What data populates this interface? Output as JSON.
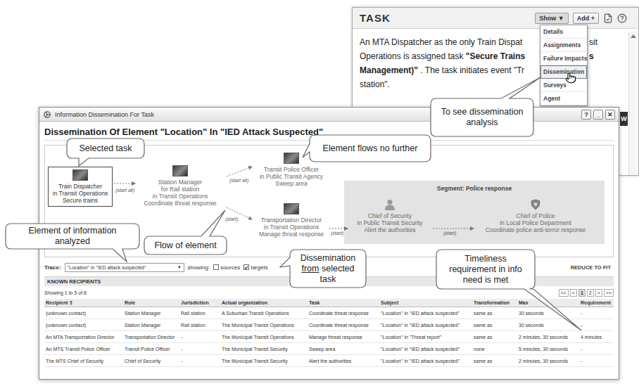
{
  "back_window": {
    "title": "TASK",
    "buttons": [
      {
        "label": "Show ▼",
        "open": true
      },
      {
        "label": "Add +",
        "open": false
      }
    ],
    "body_lines": [
      {
        "left": [
          {
            "text": "An MTA Dispatcher as the only Train Dispat",
            "bold": false
          }
        ],
        "right": [
          {
            "text": "sit",
            "bold": false
          }
        ]
      },
      {
        "left": [
          {
            "text": "Operations is assigned task ",
            "bold": false
          },
          {
            "text": "\"Secure Trains",
            "bold": true
          }
        ],
        "right": [
          {
            "text": "s",
            "bold": true
          }
        ]
      },
      {
        "left": [
          {
            "text": "Management)\"",
            "bold": true
          },
          {
            "text": " . The task initiates event \"Tr",
            "bold": false
          }
        ],
        "right": []
      },
      {
        "left": [
          {
            "text": "station\".",
            "bold": false
          }
        ],
        "right": []
      }
    ],
    "menu": [
      {
        "label": "Details",
        "selected": false
      },
      {
        "label": "Assignments",
        "selected": false
      },
      {
        "label": "Failure Impacts",
        "selected": false
      },
      {
        "label": "Dissemination",
        "selected": true
      },
      {
        "label": "Surveys",
        "selected": false
      },
      {
        "label": "Agent",
        "selected": false
      }
    ],
    "edge_tab": "W"
  },
  "window": {
    "title": "Information Dissemination For Task",
    "buttons": [
      "?",
      "_",
      "✕"
    ]
  },
  "heading": "Dissemination Of Element \"Location\" In \"IED Attack Suspected\"",
  "diagram": {
    "segment": {
      "title": "Segment: Police response"
    },
    "nodes": [
      {
        "kind": "photo",
        "selected": true,
        "lines": [
          "Train Dispatcher",
          "in Transit Operations",
          "Secure trains"
        ]
      },
      {
        "kind": "photo",
        "selected": false,
        "lines": [
          "Station Manager",
          "for Rail station",
          "in Transit Operations",
          "Coordinate threat response"
        ]
      },
      {
        "kind": "photo",
        "selected": false,
        "lines": [
          "Transit Police Officer",
          "in Public Transit Agency",
          "Sweep area"
        ]
      },
      {
        "kind": "photo",
        "selected": false,
        "lines": [
          "Transportation Director",
          "in Transit Operations",
          "Manage threat response"
        ]
      },
      {
        "kind": "person",
        "selected": false,
        "lines": [
          "Chief of Security",
          "in Public Transit Security",
          "Alert the authorities"
        ]
      },
      {
        "kind": "badge",
        "selected": false,
        "lines": [
          "Chief of Police",
          "in Local Police Department",
          "Coordinate police anti-terror response"
        ]
      }
    ],
    "edges": [
      {
        "from": 0,
        "to": 1,
        "label": "(start all)"
      },
      {
        "from": 1,
        "to": 2,
        "label": "(start all)"
      },
      {
        "from": 1,
        "to": 3,
        "label": "(start)"
      },
      {
        "from": 3,
        "to": 4,
        "label": "(start)"
      },
      {
        "from": 4,
        "to": 5,
        "label": "(start)"
      }
    ]
  },
  "trace": {
    "label": "Trace:",
    "value": "\"Location\" in \"IED attack suspected\"",
    "arrow": "▼",
    "showing_label": "showing:",
    "options": [
      {
        "label": "sources",
        "checked": false
      },
      {
        "label": "targets",
        "checked": true
      }
    ],
    "reduce": "REDUCE TO FIT"
  },
  "recipients": {
    "title": "KNOWN RECIPIENTS",
    "showing": "Showing 1 to 5 of 8",
    "pages": [
      {
        "label": "<<",
        "selected": false
      },
      {
        "label": "<",
        "selected": false
      },
      {
        "label": "1",
        "selected": true
      },
      {
        "label": "2",
        "selected": false
      },
      {
        "label": ">",
        "selected": false
      },
      {
        "label": ">>",
        "selected": false
      }
    ],
    "sort_glyph": "⇧",
    "columns": [
      "Recipient",
      "Role",
      "Jurisdiction",
      "Actual organization",
      "Task",
      "Subject",
      "Transformation",
      "Max",
      "Requirement"
    ],
    "rows": [
      [
        "(unknown contact)",
        "Station Manager",
        "Rail station",
        "A Suburban Transit Operations",
        "Coordinate threat response",
        "\"Location\" in \"IED attack suspected\"",
        "same as",
        "30 seconds",
        "-"
      ],
      [
        "(unknown contact)",
        "Station Manager",
        "Rail station",
        "The Municipal Transit Operations",
        "Coordinate threat response",
        "\"Location\" in \"IED attack suspected\"",
        "same as",
        "30 seconds",
        "-"
      ],
      [
        "An MTA Transportation Director",
        "Transportation Director",
        "-",
        "The Municipal Transit Operations",
        "Manage threat response",
        "\"Location\" in \"Threat report\"",
        "same as",
        "2 minutes, 30 seconds",
        "4 minutes"
      ],
      [
        "An MTS Transit Police Officer",
        "Transit Police Officer",
        "-",
        "The Municipal Transit Security",
        "Sweep area",
        "\"Location\" in \"IED attack suspected\"",
        "none",
        "5 minutes, 30 seconds",
        "-"
      ],
      [
        "The MTS Chief of Security",
        "Chief of Security",
        "-",
        "The Municipal Transit Security",
        "Alert the authorities",
        "\"Location\" in \"IED attack suspected\"",
        "same as",
        "2 minutes, 30 seconds",
        "-"
      ]
    ]
  },
  "callouts": [
    {
      "text": [
        {
          "text": "Selected task",
          "underline": false
        }
      ]
    },
    {
      "text": [
        {
          "text": "Element flows no further",
          "underline": false
        }
      ]
    },
    {
      "text": [
        {
          "text": "Element of information analyzed",
          "underline": false
        }
      ]
    },
    {
      "text": [
        {
          "text": "Flow of element",
          "underline": false
        }
      ]
    },
    {
      "text": [
        {
          "text": "Dissemination ",
          "underline": false
        },
        {
          "text": "from",
          "underline": true
        },
        {
          "text": " selected task",
          "underline": false
        }
      ]
    },
    {
      "text": [
        {
          "text": "Timeliness requirement in info need is met",
          "underline": false
        }
      ]
    },
    {
      "text": [
        {
          "text": "To see dissemination analysis",
          "underline": false
        }
      ]
    }
  ]
}
